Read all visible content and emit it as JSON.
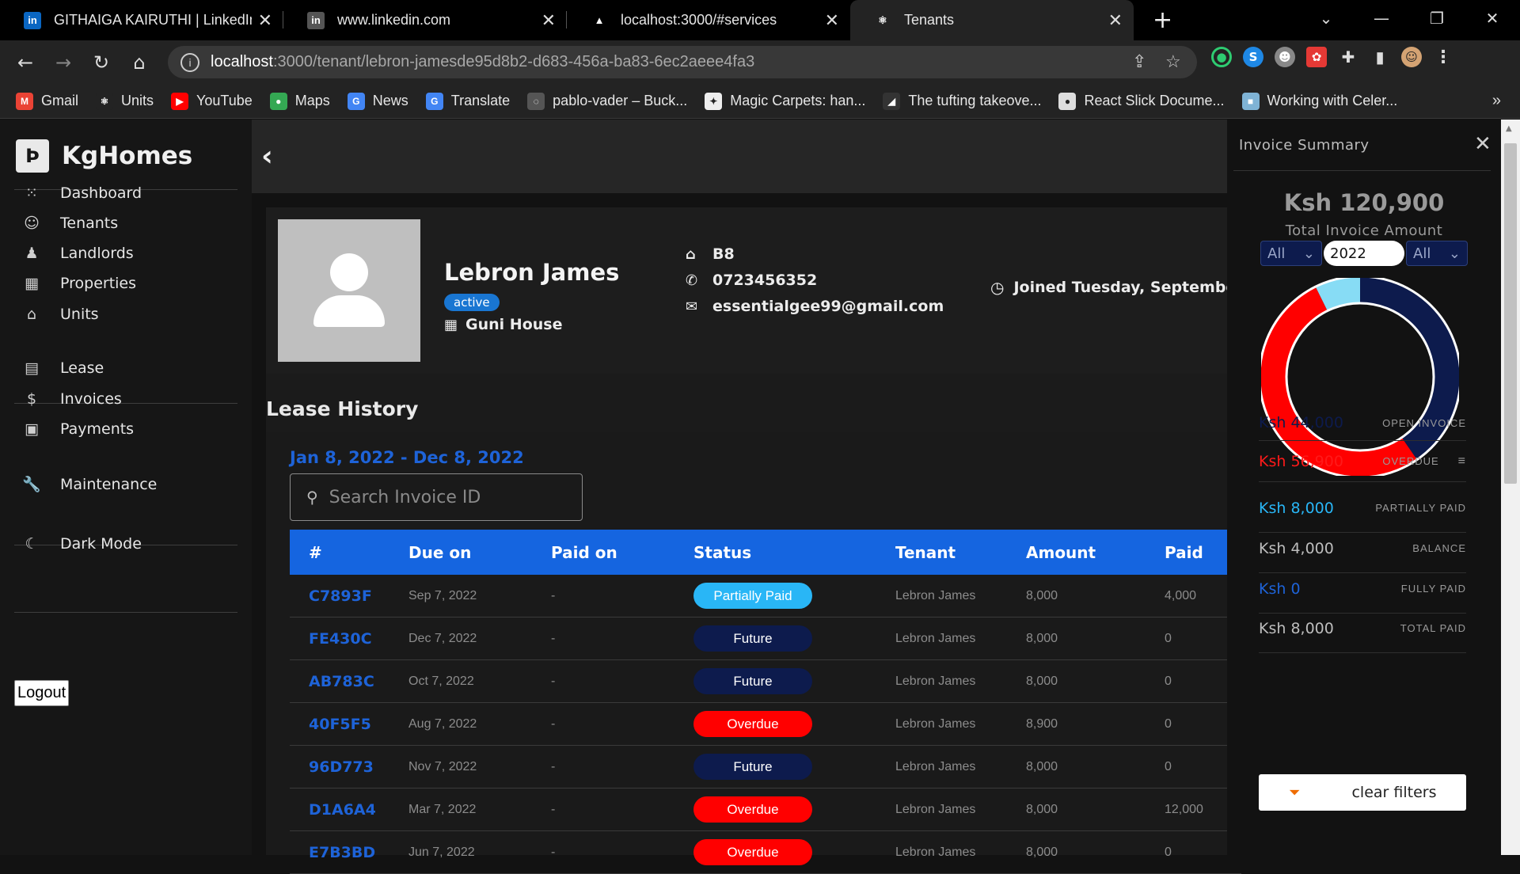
{
  "browser": {
    "tabs": [
      {
        "label": "GITHAIGA KAIRUTHI | LinkedIn",
        "icon": "linkedin-icon",
        "color": "#0a66c2",
        "glyph": "in"
      },
      {
        "label": "www.linkedin.com",
        "icon": "linkedin-icon",
        "color": "#555",
        "glyph": "in"
      },
      {
        "label": "localhost:3000/#services",
        "icon": "triangle-icon",
        "color": "#000",
        "glyph": "▲"
      },
      {
        "label": "Tenants",
        "icon": "react-icon",
        "color": "#232323",
        "glyph": "⚛"
      }
    ],
    "url_host": "localhost",
    "url_path": ":3000/tenant/lebron-jamesde95d8b2-d683-456a-ba83-6ec2aeee4fa3",
    "bookmarks": [
      {
        "label": "Gmail",
        "icon": "gmail-icon",
        "color": "#ea4335",
        "glyph": "M"
      },
      {
        "label": "Units",
        "icon": "react-icon",
        "color": "#232323",
        "glyph": "⚛"
      },
      {
        "label": "YouTube",
        "icon": "youtube-icon",
        "color": "#ff0000",
        "glyph": "▶"
      },
      {
        "label": "Maps",
        "icon": "maps-icon",
        "color": "#34a853",
        "glyph": "●"
      },
      {
        "label": "News",
        "icon": "news-icon",
        "color": "#4285f4",
        "glyph": "G"
      },
      {
        "label": "Translate",
        "icon": "translate-icon",
        "color": "#4285f4",
        "glyph": "G"
      },
      {
        "label": "pablo-vader – Buck...",
        "icon": "globe-icon",
        "color": "#555",
        "glyph": "◌"
      },
      {
        "label": "Magic Carpets: han...",
        "icon": "magic-icon",
        "color": "#eee",
        "glyph": "✦"
      },
      {
        "label": "The tufting takeove...",
        "icon": "tufting-icon",
        "color": "#333",
        "glyph": "◢"
      },
      {
        "label": "React Slick Docume...",
        "icon": "globe-icon",
        "color": "#ddd",
        "glyph": "●"
      },
      {
        "label": "Working with Celer...",
        "icon": "cube-icon",
        "color": "#7fb3d5",
        "glyph": "■"
      }
    ]
  },
  "app": {
    "brand": "KgHomes",
    "nav": [
      {
        "label": "Dashboard",
        "icon": "dashboard-icon",
        "glyph": "⁙"
      },
      {
        "label": "Tenants",
        "icon": "tenants-icon",
        "glyph": "☺"
      },
      {
        "label": "Landlords",
        "icon": "landlord-icon",
        "glyph": "♟"
      },
      {
        "label": "Properties",
        "icon": "properties-icon",
        "glyph": "▦"
      },
      {
        "label": "Units",
        "icon": "home-icon",
        "glyph": "⌂"
      },
      {
        "label": "Lease",
        "icon": "document-icon",
        "glyph": "▤"
      },
      {
        "label": "Invoices",
        "icon": "invoice-icon",
        "glyph": "$"
      },
      {
        "label": "Payments",
        "icon": "payment-icon",
        "glyph": "▣"
      },
      {
        "label": "Maintenance",
        "icon": "wrench-icon",
        "glyph": "🔧"
      },
      {
        "label": "Dark Mode",
        "icon": "moon-icon",
        "glyph": "☾"
      }
    ],
    "logout_label": "Logout"
  },
  "profile": {
    "name": "Lebron James",
    "status": "active",
    "house": "Guni House",
    "unit": "B8",
    "phone": "0723456352",
    "email": "essentialgee99@gmail.com",
    "joined": "Joined Tuesday, September"
  },
  "lease": {
    "title": "Lease History",
    "date_range": "Jan 8, 2022 - Dec 8, 2022",
    "search_placeholder": "Search Invoice ID",
    "columns": [
      "#",
      "Due on",
      "Paid on",
      "Status",
      "Tenant",
      "Amount",
      "Paid"
    ],
    "rows": [
      {
        "id": "C7893F",
        "due": "Sep 7, 2022",
        "paid_on": "-",
        "status": "Partially Paid",
        "status_color": "#29b6f6",
        "tenant": "Lebron James",
        "amount": "8,000",
        "paid": "4,000"
      },
      {
        "id": "FE430C",
        "due": "Dec 7, 2022",
        "paid_on": "-",
        "status": "Future",
        "status_color": "#0d1b4d",
        "tenant": "Lebron James",
        "amount": "8,000",
        "paid": "0"
      },
      {
        "id": "AB783C",
        "due": "Oct 7, 2022",
        "paid_on": "-",
        "status": "Future",
        "status_color": "#0d1b4d",
        "tenant": "Lebron James",
        "amount": "8,000",
        "paid": "0"
      },
      {
        "id": "40F5F5",
        "due": "Aug 7, 2022",
        "paid_on": "-",
        "status": "Overdue",
        "status_color": "#ff0000",
        "tenant": "Lebron James",
        "amount": "8,900",
        "paid": "0"
      },
      {
        "id": "96D773",
        "due": "Nov 7, 2022",
        "paid_on": "-",
        "status": "Future",
        "status_color": "#0d1b4d",
        "tenant": "Lebron James",
        "amount": "8,000",
        "paid": "0"
      },
      {
        "id": "D1A6A4",
        "due": "Mar 7, 2022",
        "paid_on": "-",
        "status": "Overdue",
        "status_color": "#ff0000",
        "tenant": "Lebron James",
        "amount": "8,000",
        "paid": "12,000"
      },
      {
        "id": "E7B3BD",
        "due": "Jun 7, 2022",
        "paid_on": "-",
        "status": "Overdue",
        "status_color": "#ff0000",
        "tenant": "Lebron James",
        "amount": "8,000",
        "paid": "0"
      }
    ]
  },
  "summary": {
    "title": "Invoice Summary",
    "total_amount": "Ksh 120,900",
    "total_label": "Total Invoice Amount",
    "filter_status": "All",
    "filter_year": "2022",
    "filter_month": "All",
    "donut": [
      {
        "name": "Open invoice",
        "value": 44000,
        "color": "#0d1b4d"
      },
      {
        "name": "Overdue",
        "value": 56900,
        "color": "#ff0000"
      },
      {
        "name": "Partially paid",
        "value": 8000,
        "color": "#87dcf5"
      }
    ],
    "rows": [
      {
        "amount": "Ksh 44,000",
        "label": "OPEN INVOICE",
        "color": "#0d1b4d"
      },
      {
        "amount": "Ksh 56,900",
        "label": "OVERDUE",
        "color": "#ff1a1a"
      },
      {
        "amount": "Ksh 8,000",
        "label": "PARTIALLY PAID",
        "color": "#29b6f6"
      },
      {
        "amount": "Ksh 4,000",
        "label": "BALANCE",
        "color": "#bdbdbd"
      },
      {
        "amount": "Ksh 0",
        "label": "FULLY PAID",
        "color": "#1e63d8"
      },
      {
        "amount": "Ksh 8,000",
        "label": "TOTAL PAID",
        "color": "#bdbdbd"
      }
    ],
    "clear_label": "clear filters"
  }
}
